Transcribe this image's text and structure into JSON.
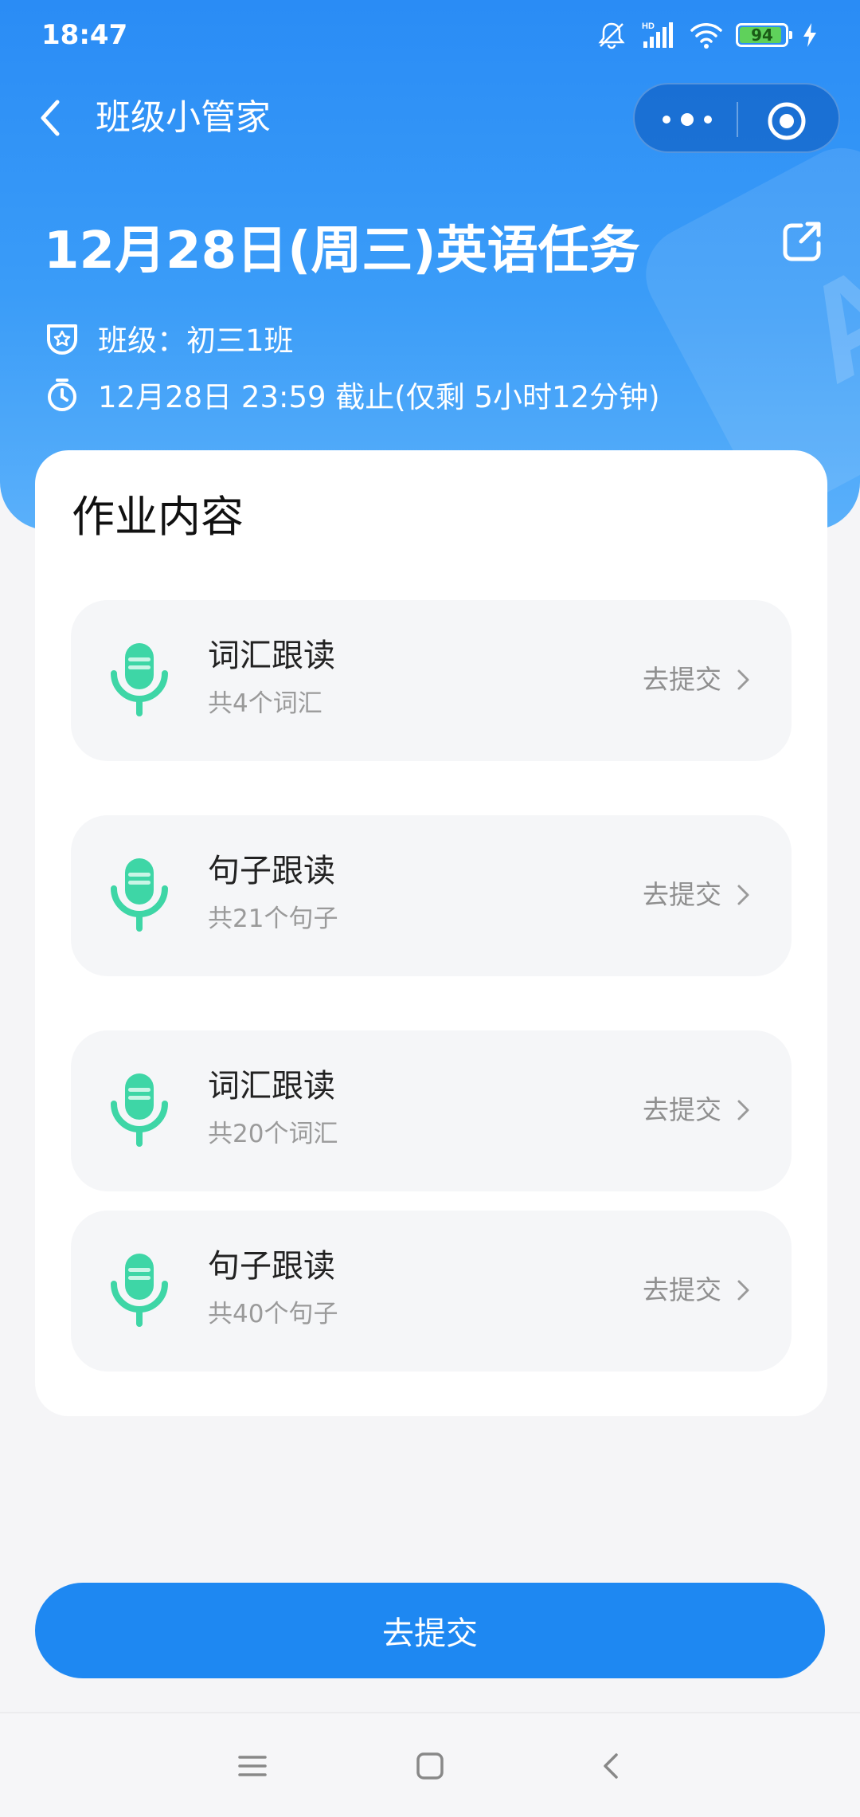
{
  "status_bar": {
    "time": "18:47",
    "battery_level": "94",
    "icons": [
      "mute-bell-icon",
      "hd-signal-icon",
      "wifi-icon",
      "battery-icon",
      "charging-icon"
    ]
  },
  "nav": {
    "title": "班级小管家",
    "back_icon": "chevron-left-icon",
    "more_icon": "more-dots-icon",
    "close_icon": "target-circle-icon"
  },
  "task": {
    "title": "12月28日(周三)英语任务",
    "class_label": "班级：初三1班",
    "deadline": "12月28日 23:59 截止(仅剩 5小时12分钟)",
    "share_icon": "share-icon"
  },
  "content": {
    "section_title": "作业内容",
    "items": [
      {
        "name": "词汇跟读",
        "count": "共4个词汇",
        "action": "去提交",
        "icon": "microphone-icon"
      },
      {
        "name": "句子跟读",
        "count": "共21个句子",
        "action": "去提交",
        "icon": "microphone-icon"
      },
      {
        "name": "词汇跟读",
        "count": "共20个词汇",
        "action": "去提交",
        "icon": "microphone-icon"
      },
      {
        "name": "句子跟读",
        "count": "共40个句子",
        "action": "去提交",
        "icon": "microphone-icon"
      }
    ]
  },
  "submit_button": {
    "label": "去提交"
  },
  "colors": {
    "primary": "#1e88f2",
    "mic_green": "#3ed6a6",
    "card_bg": "#f5f6f8",
    "page_bg": "#f5f5f7"
  }
}
